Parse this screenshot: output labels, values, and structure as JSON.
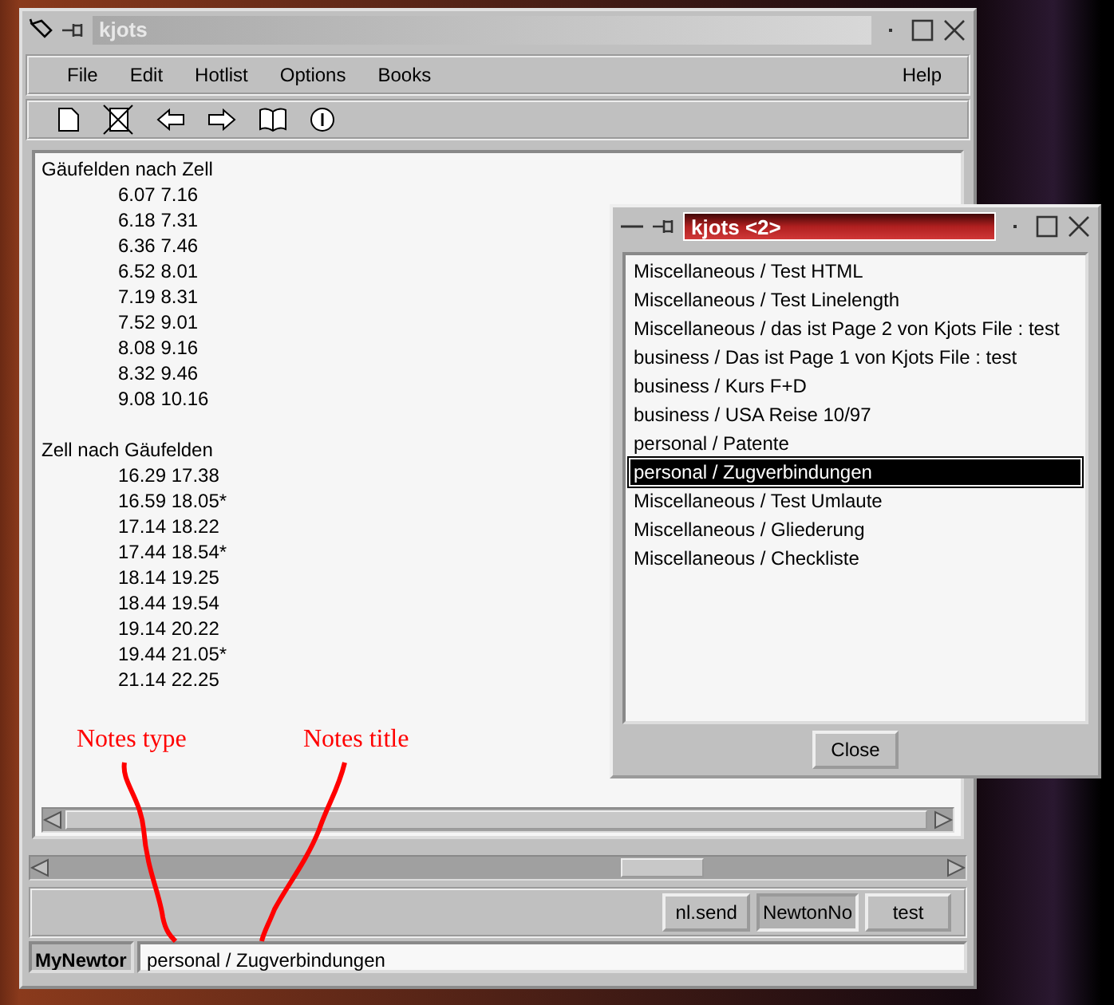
{
  "main_window": {
    "title": "kjots",
    "menu": [
      {
        "label": "File"
      },
      {
        "label": "Edit"
      },
      {
        "label": "Hotlist"
      },
      {
        "label": "Options"
      },
      {
        "label": "Books"
      },
      {
        "label": "Help"
      }
    ],
    "sections": [
      {
        "heading": "Gäufelden nach Zell",
        "entries": [
          "6.07 7.16",
          "6.18 7.31",
          "6.36 7.46",
          "6.52 8.01",
          "7.19 8.31",
          "7.52 9.01",
          "8.08 9.16",
          "8.32 9.46",
          "9.08 10.16"
        ]
      },
      {
        "heading": "Zell nach Gäufelden",
        "entries": [
          "16.29 17.38",
          "16.59 18.05*",
          "17.14 18.22",
          "17.44 18.54*",
          "18.14 19.25",
          "18.44 19.54",
          "19.14 20.22",
          "19.44 21.05*",
          "21.14 22.25"
        ]
      }
    ],
    "hotlist_buttons": [
      {
        "label": "nl.send",
        "selected": false
      },
      {
        "label": "NewtonNo",
        "selected": true
      },
      {
        "label": "test",
        "selected": false
      }
    ],
    "book_label": "MyNewtor",
    "note_title": "personal / Zugverbindungen"
  },
  "list_window": {
    "title": "kjots <2>",
    "items": [
      {
        "label": "Miscellaneous / Test HTML",
        "selected": false
      },
      {
        "label": "Miscellaneous / Test Linelength",
        "selected": false
      },
      {
        "label": "Miscellaneous / das ist Page 2 von Kjots File : test",
        "selected": false
      },
      {
        "label": "business / Das ist Page 1 von Kjots File : test",
        "selected": false
      },
      {
        "label": "business / Kurs F+D",
        "selected": false
      },
      {
        "label": "business / USA Reise 10/97",
        "selected": false
      },
      {
        "label": "personal / Patente",
        "selected": false
      },
      {
        "label": "personal / Zugverbindungen",
        "selected": true
      },
      {
        "label": "Miscellaneous / Test Umlaute",
        "selected": false
      },
      {
        "label": "Miscellaneous / Gliederung",
        "selected": false
      },
      {
        "label": "Miscellaneous / Checkliste",
        "selected": false
      }
    ],
    "close_button": "Close"
  },
  "annotations": [
    {
      "text": "Notes type"
    },
    {
      "text": "Notes title"
    }
  ]
}
